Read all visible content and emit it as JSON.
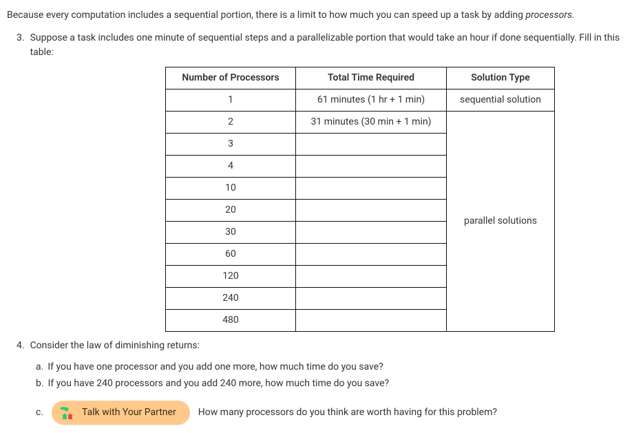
{
  "intro_pre": "Because every computation includes a sequential portion, there is a limit to how much you can speed up a task by adding ",
  "intro_em": "processors.",
  "q3": {
    "marker": "3.",
    "text": "Suppose a task includes one minute of sequential steps and a parallelizable portion that would take an hour if done sequentially. Fill in this table:"
  },
  "table": {
    "headers": {
      "proc": "Number of Processors",
      "time": "Total Time Required",
      "type": "Solution Type"
    },
    "rows": [
      {
        "proc": "1",
        "time": "61 minutes (1 hr + 1 min)",
        "type": "sequential solution"
      },
      {
        "proc": "2",
        "time": "31 minutes (30 min + 1 min)"
      },
      {
        "proc": "3",
        "time": ""
      },
      {
        "proc": "4",
        "time": ""
      },
      {
        "proc": "10",
        "time": ""
      },
      {
        "proc": "20",
        "time": ""
      },
      {
        "proc": "30",
        "time": ""
      },
      {
        "proc": "60",
        "time": ""
      },
      {
        "proc": "120",
        "time": ""
      },
      {
        "proc": "240",
        "time": ""
      },
      {
        "proc": "480",
        "time": ""
      }
    ],
    "parallel_label": "parallel solutions"
  },
  "q4": {
    "marker": "4.",
    "text": "Consider the law of diminishing returns:",
    "a": {
      "marker": "a.",
      "text": "If you have one processor and you add one more, how much time do you save?"
    },
    "b": {
      "marker": "b.",
      "text": "If you have 240 processors and you add 240 more, how much time do you save?"
    },
    "c": {
      "marker": "c.",
      "pill_label": "Talk with Your Partner",
      "text": "How many processors do you think are worth having for this problem?"
    }
  }
}
